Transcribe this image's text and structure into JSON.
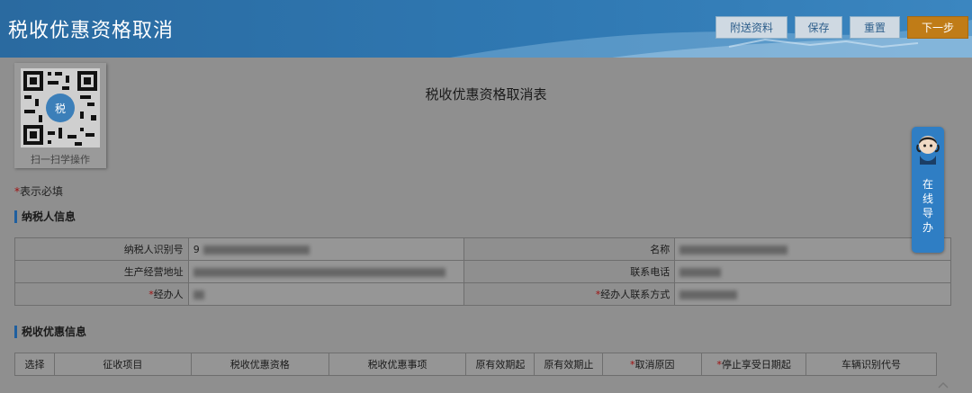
{
  "header": {
    "title": "税收优惠资格取消",
    "buttons": {
      "attach": "附送资料",
      "save": "保存",
      "reset": "重置",
      "next": "下一步"
    }
  },
  "qr": {
    "caption": "扫一扫学操作"
  },
  "form": {
    "title": "税收优惠资格取消表",
    "required_note": "表示必填",
    "required_mark": "*"
  },
  "taxpayer_section": {
    "title": "纳税人信息",
    "rows": [
      {
        "label_left": "纳税人识别号",
        "value_left": "9",
        "label_right": "名称",
        "value_right": ""
      },
      {
        "label_left": "生产经营地址",
        "value_left": "",
        "label_right": "联系电话",
        "value_right": ""
      },
      {
        "label_left": "经办人",
        "value_left": "",
        "label_right": "经办人联系方式",
        "value_right": ""
      }
    ]
  },
  "tax_section": {
    "title": "税收优惠信息",
    "columns": [
      "选择",
      "征收项目",
      "税收优惠资格",
      "税收优惠事项",
      "原有效期起",
      "原有效期止",
      "取消原因",
      "停止享受日期起",
      "车辆识别代号"
    ]
  },
  "online_guide": {
    "chars": [
      "在",
      "线",
      "导",
      "办"
    ]
  },
  "icons": {
    "qr": "qr-code-icon",
    "guide_avatar": "customer-service-avatar-icon",
    "scroll_up": "chevron-up-icon"
  },
  "colors": {
    "header": "#2f78b2",
    "next_button": "#c07c17",
    "required": "#a01010",
    "section_accent": "#1f5f9f",
    "guide_widget": "#2f7ec4"
  }
}
